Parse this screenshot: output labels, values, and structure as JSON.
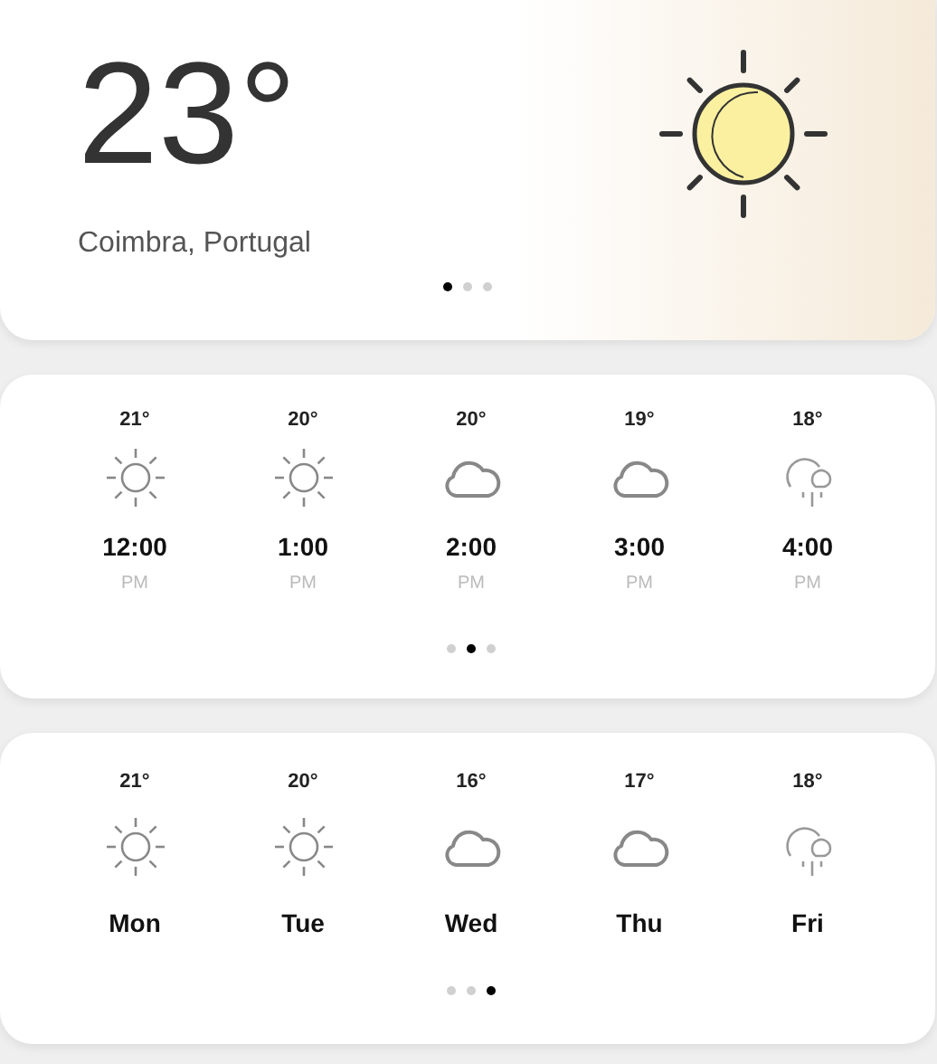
{
  "current": {
    "temperature": "23°",
    "location": "Coimbra, Portugal",
    "kind": "sun",
    "pager": [
      {
        "selected": true
      },
      {
        "selected": false
      },
      {
        "selected": false
      }
    ]
  },
  "hourly": {
    "items": [
      {
        "temp": "21°",
        "kind": "sun",
        "time": "12:00",
        "period": "PM"
      },
      {
        "temp": "20°",
        "kind": "sun",
        "time": "1:00",
        "period": "PM"
      },
      {
        "temp": "20°",
        "kind": "cloud",
        "time": "2:00",
        "period": "PM"
      },
      {
        "temp": "19°",
        "kind": "cloud",
        "time": "3:00",
        "period": "PM"
      },
      {
        "temp": "18°",
        "kind": "rain",
        "time": "4:00",
        "period": "PM"
      }
    ],
    "pager": [
      {
        "selected": false
      },
      {
        "selected": true
      },
      {
        "selected": false
      }
    ]
  },
  "daily": {
    "items": [
      {
        "temp": "21°",
        "kind": "sun",
        "day": "Mon"
      },
      {
        "temp": "20°",
        "kind": "sun",
        "day": "Tue"
      },
      {
        "temp": "16°",
        "kind": "cloud",
        "day": "Wed"
      },
      {
        "temp": "17°",
        "kind": "cloud",
        "day": "Thu"
      },
      {
        "temp": "18°",
        "kind": "rain",
        "day": "Fri"
      }
    ],
    "pager": [
      {
        "selected": false
      },
      {
        "selected": false
      },
      {
        "selected": true
      }
    ]
  }
}
